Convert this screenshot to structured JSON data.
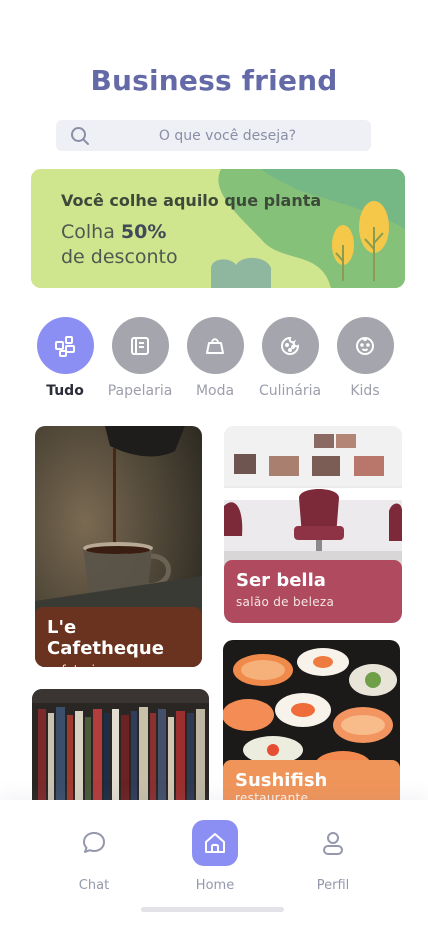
{
  "app": {
    "title": "Business friend"
  },
  "search": {
    "placeholder": "O que você deseja?",
    "icon": "search-icon"
  },
  "banner": {
    "title": "Você colhe aquilo que planta",
    "line2_prefix": "Colha ",
    "discount": "50%",
    "line3": "de desconto",
    "colors": {
      "background": "#cfe58e",
      "shape": "#86c17a",
      "accent": "#f5c84a"
    }
  },
  "categories": [
    {
      "label": "Tudo",
      "icon": "grid-icon",
      "active": true
    },
    {
      "label": "Papelaria",
      "icon": "notebook-icon",
      "active": false
    },
    {
      "label": "Moda",
      "icon": "shopping-bag-icon",
      "active": false
    },
    {
      "label": "Culinária",
      "icon": "cookie-icon",
      "active": false
    },
    {
      "label": "Kids",
      "icon": "baby-face-icon",
      "active": false
    }
  ],
  "businesses": {
    "cafe": {
      "name": "L'e Cafetheque",
      "category": "cafeteria",
      "color": "#6a3320"
    },
    "bella": {
      "name": "Ser bella",
      "category": "salão de beleza",
      "color": "#b04a5e"
    },
    "books": {
      "name": "",
      "category": ""
    },
    "sushi": {
      "name": "Sushifish",
      "category": "restaurante",
      "color": "#f0955a"
    }
  },
  "nav": {
    "chat": "Chat",
    "home": "Home",
    "perfil": "Perfil",
    "active": "home",
    "accent": "#8b8ff4"
  }
}
